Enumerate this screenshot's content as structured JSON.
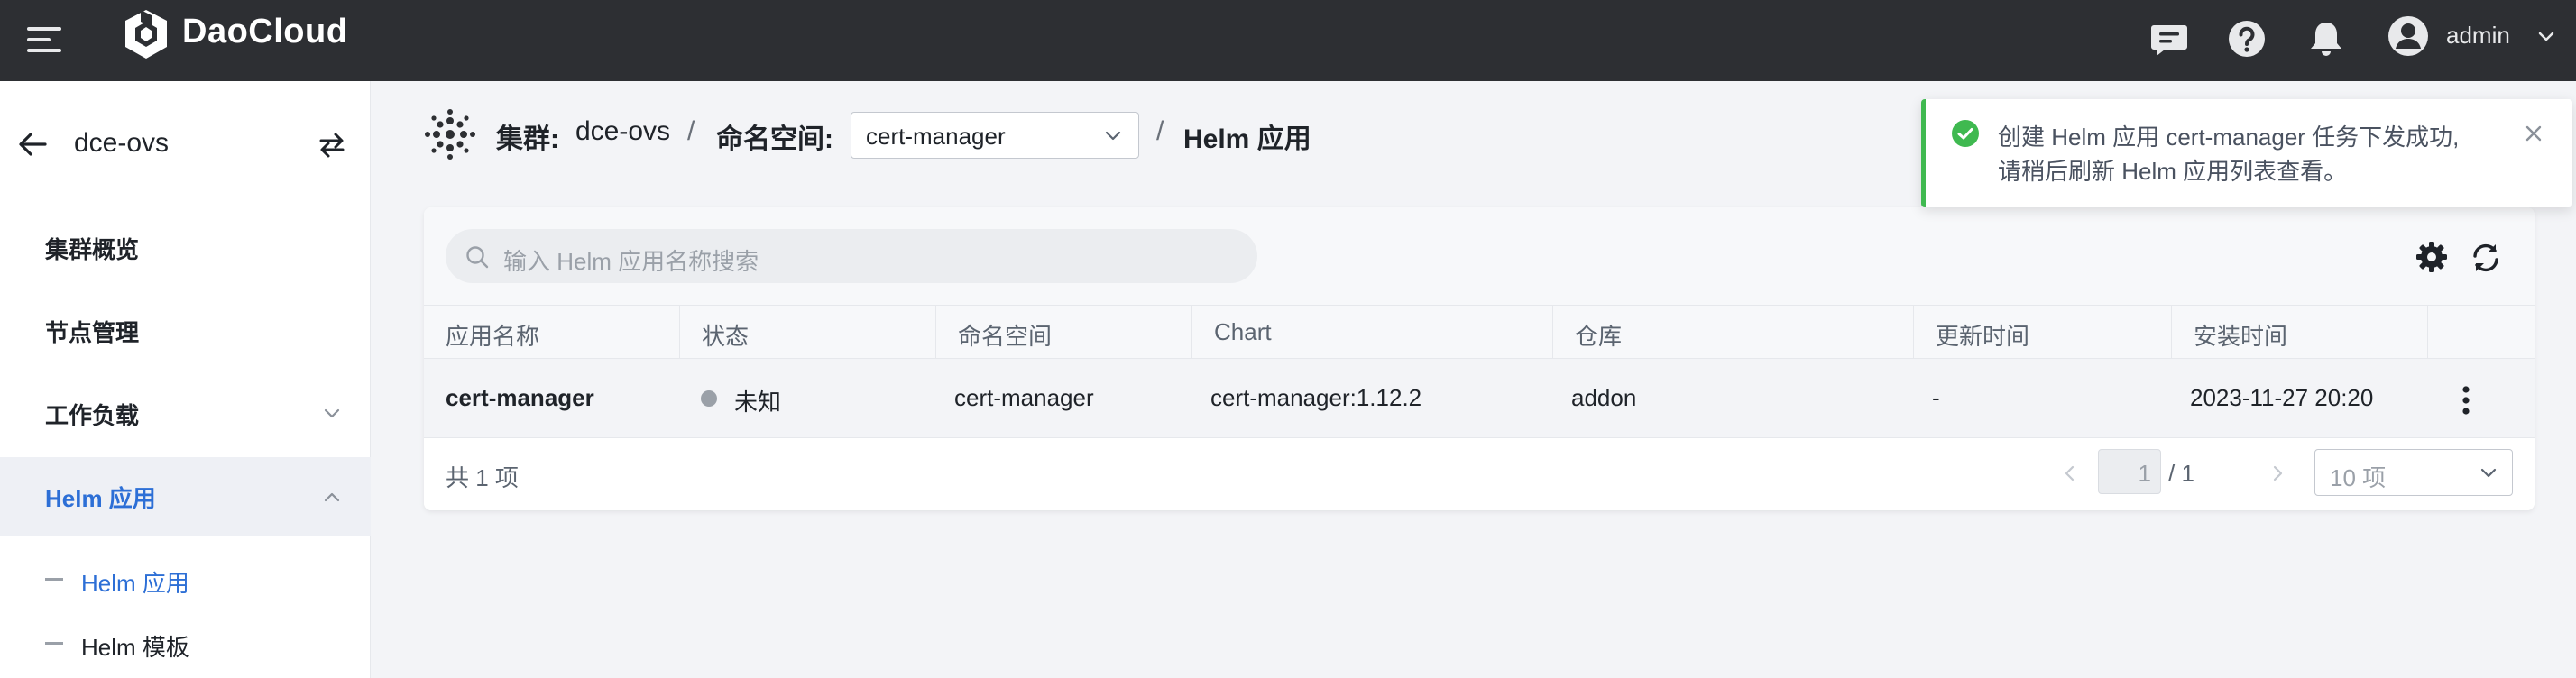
{
  "topbar": {
    "brand": "DaoCloud",
    "user": "admin",
    "icons": [
      "message-icon",
      "help-icon",
      "bell-icon",
      "user-avatar-icon"
    ]
  },
  "sidebar": {
    "cluster": "dce-ovs",
    "items": [
      {
        "label": "集群概览"
      },
      {
        "label": "节点管理"
      },
      {
        "label": "工作负载"
      },
      {
        "label": "Helm 应用"
      }
    ],
    "subitems": [
      {
        "label": "Helm 应用"
      },
      {
        "label": "Helm 模板"
      }
    ]
  },
  "breadcrumb": {
    "cluster_label": "集群:",
    "cluster_value": "dce-ovs",
    "sep": "/",
    "namespace_label": "命名空间:",
    "namespace_value": "cert-manager",
    "current": "Helm 应用"
  },
  "search": {
    "placeholder": "输入 Helm 应用名称搜索"
  },
  "table": {
    "columns": [
      "应用名称",
      "状态",
      "命名空间",
      "Chart",
      "仓库",
      "更新时间",
      "安装时间"
    ],
    "rows": [
      {
        "name": "cert-manager",
        "status": "未知",
        "namespace": "cert-manager",
        "chart": "cert-manager:1.12.2",
        "repo": "addon",
        "updated": "-",
        "installed": "2023-11-27 20:20"
      }
    ]
  },
  "pagination": {
    "total": "共 1 项",
    "page": "1",
    "of": "/ 1",
    "page_size": "10 项"
  },
  "toast": {
    "line1": "创建 Helm 应用 cert-manager 任务下发成功,",
    "line2": "请稍后刷新 Helm 应用列表查看。"
  },
  "colors": {
    "topbar": "#2d2f33",
    "accent": "#2d6fd6",
    "success": "#3fb950",
    "status_unknown": "#9aa0a8"
  }
}
